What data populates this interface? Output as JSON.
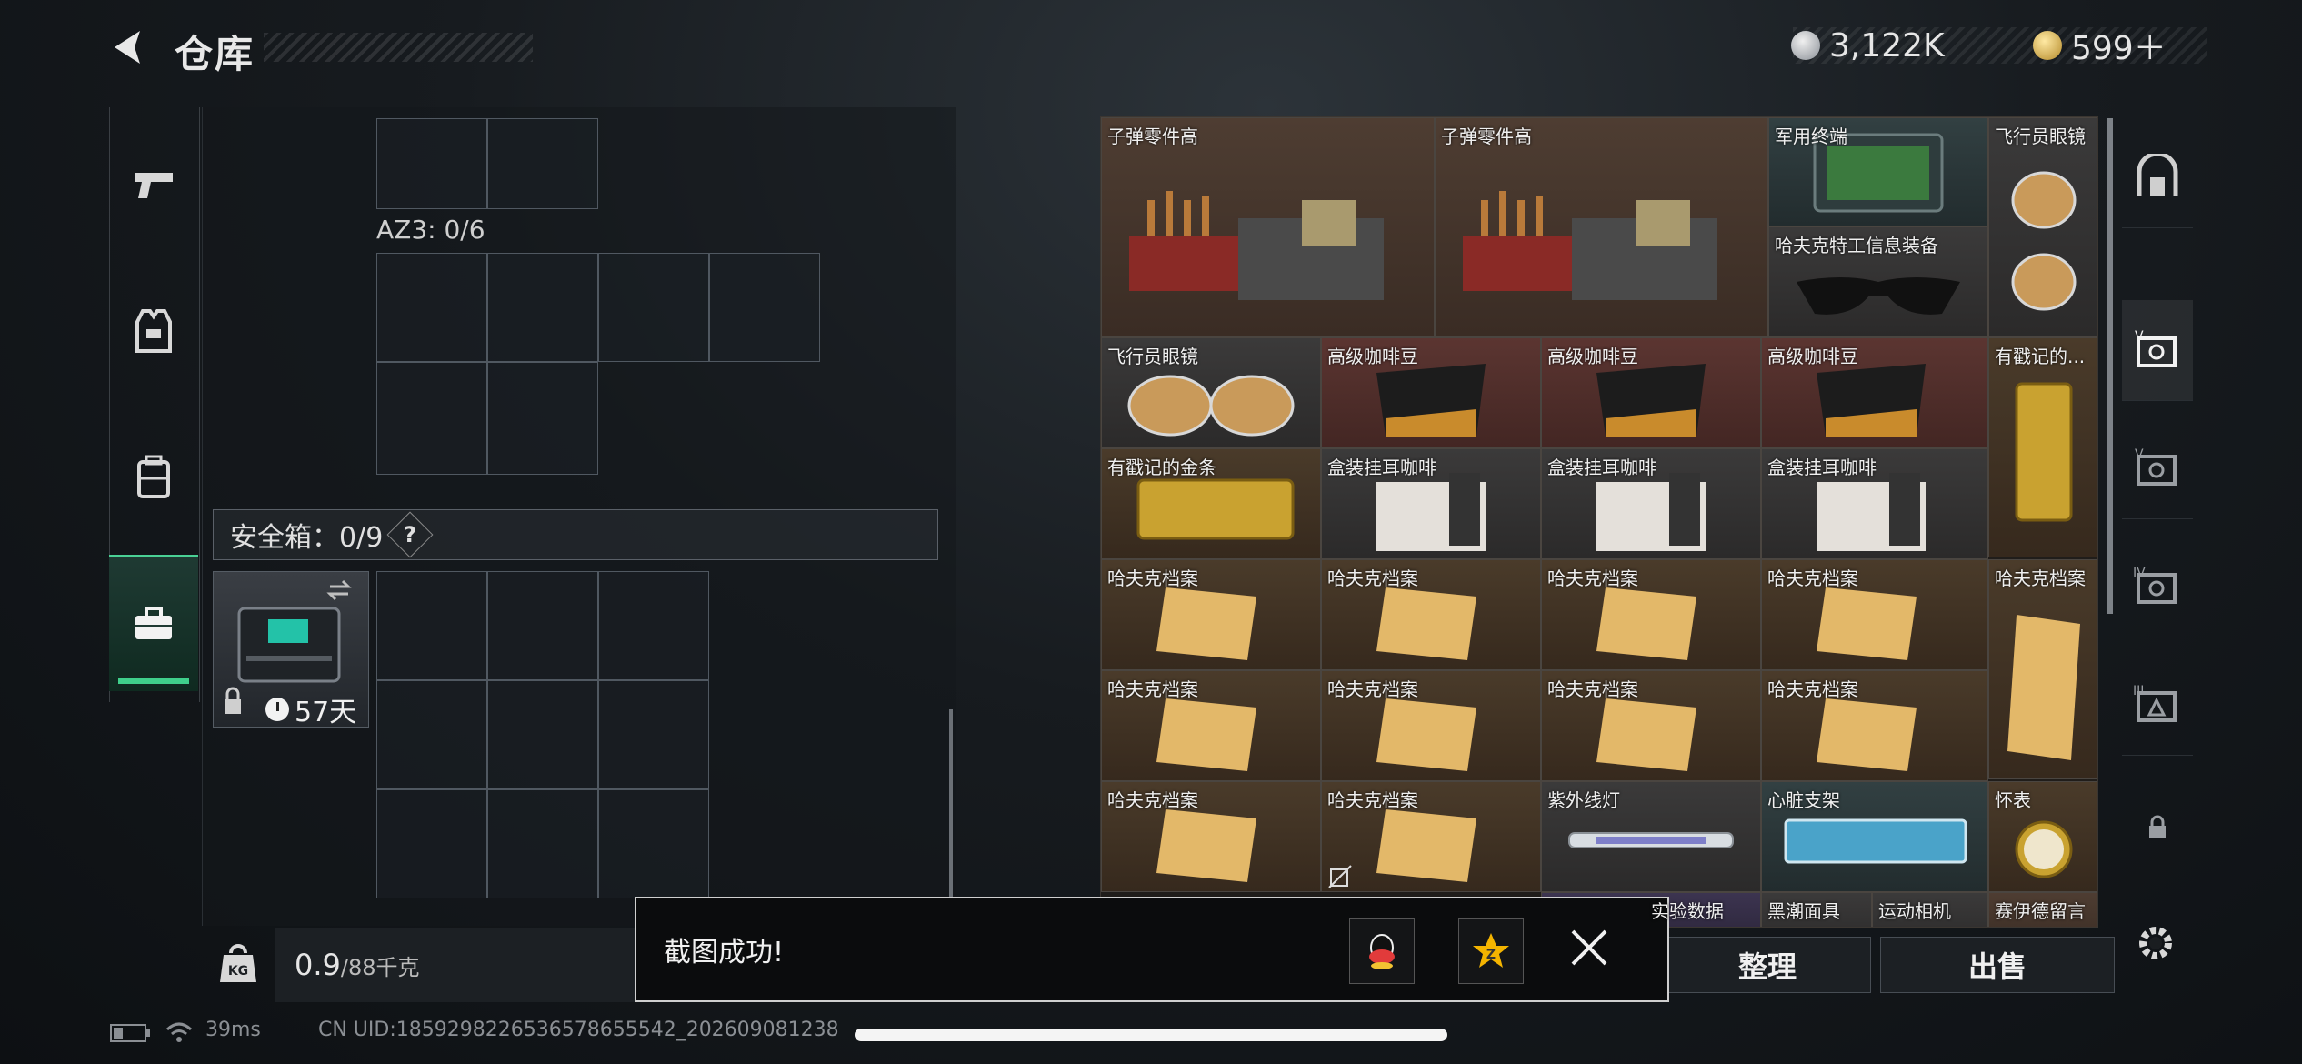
{
  "header": {
    "title": "仓库",
    "currency_silver": "3,122K",
    "currency_gold": "599＋"
  },
  "rail": {
    "items": [
      {
        "icon": "pistol-icon"
      },
      {
        "icon": "vest-icon"
      },
      {
        "icon": "backpack-icon"
      },
      {
        "icon": "briefcase-icon"
      }
    ]
  },
  "inventory": {
    "az3_label": "AZ3: 0/6",
    "safe_label": "安全箱：0/9",
    "help_label": "?",
    "safe_days": "57天",
    "weight_value": "0.9",
    "weight_unit": "/88千克"
  },
  "storage": {
    "items": [
      {
        "name": "子弹零件高"
      },
      {
        "name": "子弹零件高"
      },
      {
        "name": "军用终端"
      },
      {
        "name": "飞行员眼镜"
      },
      {
        "name": "哈夫克特工信息装备"
      },
      {
        "name": "飞行员眼镜"
      },
      {
        "name": "高级咖啡豆"
      },
      {
        "name": "高级咖啡豆"
      },
      {
        "name": "高级咖啡豆"
      },
      {
        "name": "有戳记的..."
      },
      {
        "name": "有戳记的金条"
      },
      {
        "name": "盒装挂耳咖啡"
      },
      {
        "name": "盒装挂耳咖啡"
      },
      {
        "name": "盒装挂耳咖啡"
      },
      {
        "name": "哈夫克档案"
      },
      {
        "name": "哈夫克档案"
      },
      {
        "name": "哈夫克档案"
      },
      {
        "name": "哈夫克档案"
      },
      {
        "name": "哈夫克档案"
      },
      {
        "name": "哈夫克档案"
      },
      {
        "name": "哈夫克档案"
      },
      {
        "name": "哈夫克档案"
      },
      {
        "name": "哈夫克档案"
      },
      {
        "name": "哈夫克档案"
      },
      {
        "name": "哈夫克档案"
      },
      {
        "name": "紫外线灯"
      },
      {
        "name": "心脏支架"
      },
      {
        "name": "怀表"
      },
      {
        "name": "实验数据"
      },
      {
        "name": "黑潮面具"
      },
      {
        "name": "运动相机"
      },
      {
        "name": "赛伊德留言"
      }
    ]
  },
  "buttons": {
    "sort": "整理",
    "sell": "出售"
  },
  "toast": {
    "text": "截图成功!"
  },
  "status": {
    "ping": "39ms",
    "uid": "CN UID:1859298226536578655542_202609081238"
  }
}
